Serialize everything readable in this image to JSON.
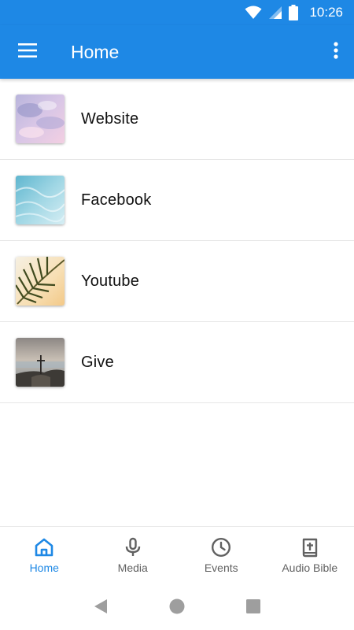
{
  "status_bar": {
    "time": "10:26"
  },
  "app_bar": {
    "title": "Home"
  },
  "list": {
    "items": [
      {
        "label": "Website",
        "image": "pastel-clouds"
      },
      {
        "label": "Facebook",
        "image": "blue-water"
      },
      {
        "label": "Youtube",
        "image": "palm-leaf"
      },
      {
        "label": "Give",
        "image": "mountain-cross"
      }
    ]
  },
  "bottom_nav": {
    "items": [
      {
        "label": "Home",
        "icon": "home-icon",
        "active": true
      },
      {
        "label": "Media",
        "icon": "microphone-icon",
        "active": false
      },
      {
        "label": "Events",
        "icon": "clock-icon",
        "active": false
      },
      {
        "label": "Audio Bible",
        "icon": "bible-icon",
        "active": false
      }
    ]
  },
  "colors": {
    "primary": "#1e88e5",
    "nav_inactive": "#616161"
  }
}
